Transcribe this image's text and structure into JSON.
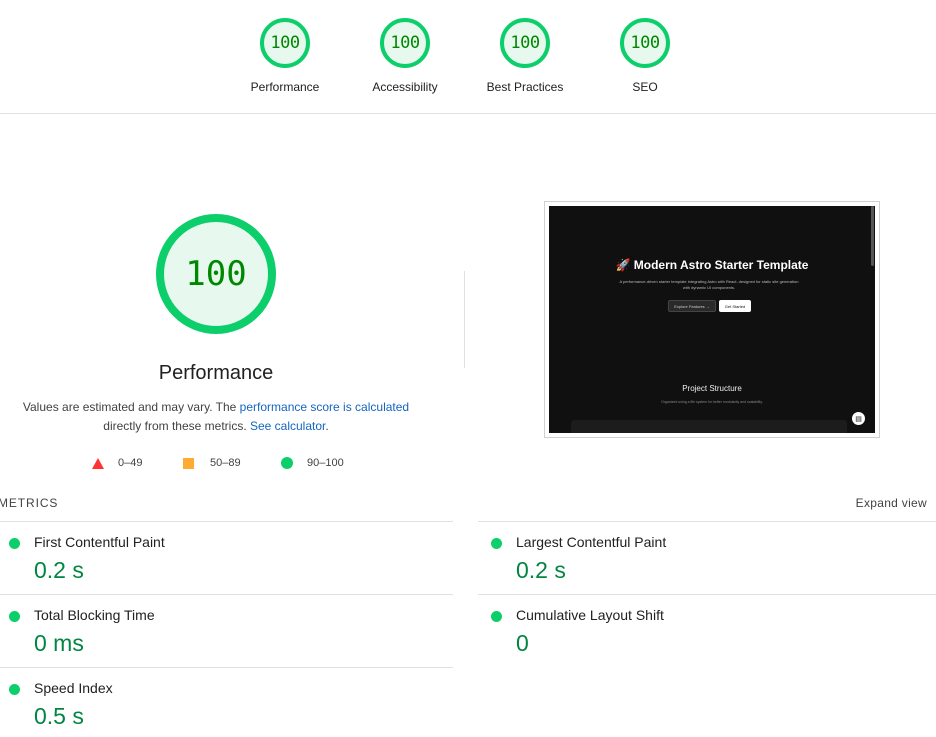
{
  "categories": [
    {
      "score": "100",
      "label": "Performance"
    },
    {
      "score": "100",
      "label": "Accessibility"
    },
    {
      "score": "100",
      "label": "Best Practices"
    },
    {
      "score": "100",
      "label": "SEO"
    }
  ],
  "performance": {
    "score": "100",
    "title": "Performance",
    "desc_part1": "Values are estimated and may vary. The ",
    "desc_link1": "performance score is calculated",
    "desc_part2": " directly from these metrics. ",
    "desc_link2": "See calculator",
    "desc_part3": "."
  },
  "legend": {
    "fail": "0–49",
    "average": "50–89",
    "pass": "90–100"
  },
  "thumbnail": {
    "heading": "🚀 Modern Astro Starter Template",
    "subtext": "A performance-driven starter template integrating Astro with React, designed for static site generation with dynamic UI components.",
    "button1": "Explore Features →",
    "button2": "Get Started",
    "section_heading": "Project Structure",
    "section_sub": "Organized using a file system for better modularity and scalability."
  },
  "metrics": {
    "title": "METRICS",
    "expand": "Expand view",
    "items": [
      {
        "name": "First Contentful Paint",
        "value": "0.2 s"
      },
      {
        "name": "Largest Contentful Paint",
        "value": "0.2 s"
      },
      {
        "name": "Total Blocking Time",
        "value": "0 ms"
      },
      {
        "name": "Cumulative Layout Shift",
        "value": "0"
      },
      {
        "name": "Speed Index",
        "value": "0.5 s"
      }
    ]
  },
  "colors": {
    "pass": "#0cce6b",
    "pass_text": "#018642",
    "average": "#ffaa33",
    "fail": "#ff3333",
    "link": "#1565c0"
  }
}
